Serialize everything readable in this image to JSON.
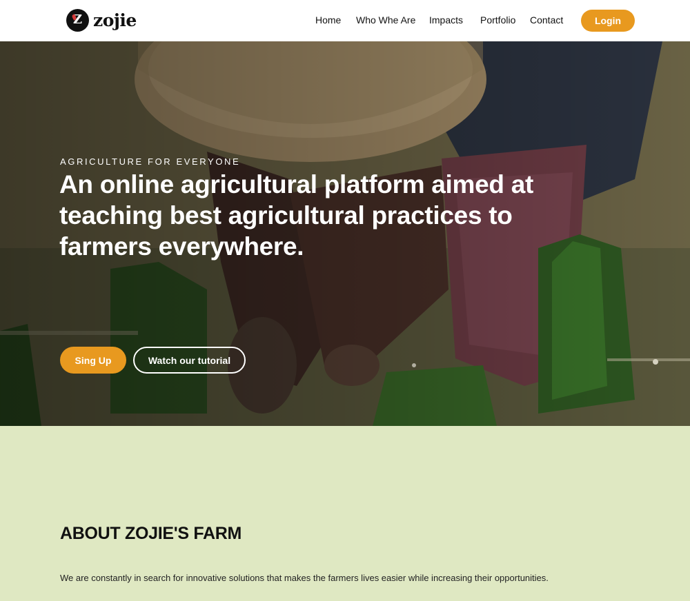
{
  "brand": {
    "name": "zojie",
    "logo_icon": "zojie-logo-icon"
  },
  "nav": {
    "links": [
      "Home",
      "Who Whe Are",
      "Impacts",
      "Portfolio",
      "Contact"
    ],
    "login_label": "Login"
  },
  "hero": {
    "eyebrow": "AGRICULTURE FOR EVERYONE",
    "headline": "An online agricultural platform aimed at teaching best agricultural practices to farmers everywhere.",
    "primary_cta": "Sing Up",
    "secondary_cta": "Watch our tutorial",
    "image_alt": "farmer-planting-rice-seedlings-image"
  },
  "about": {
    "title": "ABOUT ZOJIE'S FARM",
    "text": "We are constantly in search for innovative solutions that makes the farmers lives easier while increasing their opportunities."
  },
  "colors": {
    "accent": "#e8991f",
    "nav_bg": "#ffffff",
    "about_bg": "#dfe8c2",
    "text_dark": "#111111"
  }
}
